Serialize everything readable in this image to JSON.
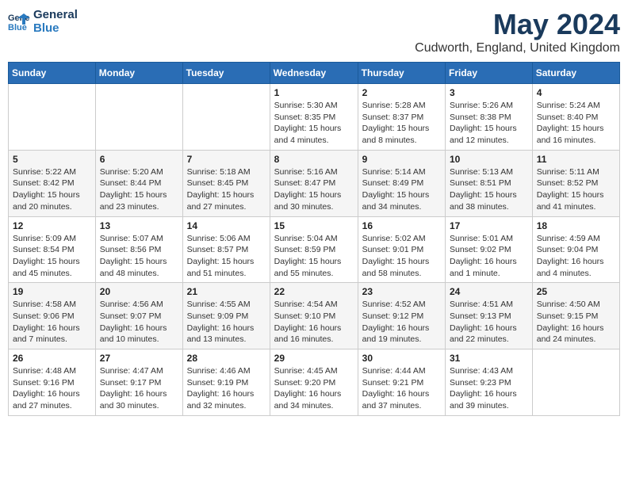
{
  "logo": {
    "line1": "General",
    "line2": "Blue"
  },
  "title": "May 2024",
  "subtitle": "Cudworth, England, United Kingdom",
  "days_of_week": [
    "Sunday",
    "Monday",
    "Tuesday",
    "Wednesday",
    "Thursday",
    "Friday",
    "Saturday"
  ],
  "weeks": [
    [
      {
        "day": "",
        "info": ""
      },
      {
        "day": "",
        "info": ""
      },
      {
        "day": "",
        "info": ""
      },
      {
        "day": "1",
        "info": "Sunrise: 5:30 AM\nSunset: 8:35 PM\nDaylight: 15 hours\nand 4 minutes."
      },
      {
        "day": "2",
        "info": "Sunrise: 5:28 AM\nSunset: 8:37 PM\nDaylight: 15 hours\nand 8 minutes."
      },
      {
        "day": "3",
        "info": "Sunrise: 5:26 AM\nSunset: 8:38 PM\nDaylight: 15 hours\nand 12 minutes."
      },
      {
        "day": "4",
        "info": "Sunrise: 5:24 AM\nSunset: 8:40 PM\nDaylight: 15 hours\nand 16 minutes."
      }
    ],
    [
      {
        "day": "5",
        "info": "Sunrise: 5:22 AM\nSunset: 8:42 PM\nDaylight: 15 hours\nand 20 minutes."
      },
      {
        "day": "6",
        "info": "Sunrise: 5:20 AM\nSunset: 8:44 PM\nDaylight: 15 hours\nand 23 minutes."
      },
      {
        "day": "7",
        "info": "Sunrise: 5:18 AM\nSunset: 8:45 PM\nDaylight: 15 hours\nand 27 minutes."
      },
      {
        "day": "8",
        "info": "Sunrise: 5:16 AM\nSunset: 8:47 PM\nDaylight: 15 hours\nand 30 minutes."
      },
      {
        "day": "9",
        "info": "Sunrise: 5:14 AM\nSunset: 8:49 PM\nDaylight: 15 hours\nand 34 minutes."
      },
      {
        "day": "10",
        "info": "Sunrise: 5:13 AM\nSunset: 8:51 PM\nDaylight: 15 hours\nand 38 minutes."
      },
      {
        "day": "11",
        "info": "Sunrise: 5:11 AM\nSunset: 8:52 PM\nDaylight: 15 hours\nand 41 minutes."
      }
    ],
    [
      {
        "day": "12",
        "info": "Sunrise: 5:09 AM\nSunset: 8:54 PM\nDaylight: 15 hours\nand 45 minutes."
      },
      {
        "day": "13",
        "info": "Sunrise: 5:07 AM\nSunset: 8:56 PM\nDaylight: 15 hours\nand 48 minutes."
      },
      {
        "day": "14",
        "info": "Sunrise: 5:06 AM\nSunset: 8:57 PM\nDaylight: 15 hours\nand 51 minutes."
      },
      {
        "day": "15",
        "info": "Sunrise: 5:04 AM\nSunset: 8:59 PM\nDaylight: 15 hours\nand 55 minutes."
      },
      {
        "day": "16",
        "info": "Sunrise: 5:02 AM\nSunset: 9:01 PM\nDaylight: 15 hours\nand 58 minutes."
      },
      {
        "day": "17",
        "info": "Sunrise: 5:01 AM\nSunset: 9:02 PM\nDaylight: 16 hours\nand 1 minute."
      },
      {
        "day": "18",
        "info": "Sunrise: 4:59 AM\nSunset: 9:04 PM\nDaylight: 16 hours\nand 4 minutes."
      }
    ],
    [
      {
        "day": "19",
        "info": "Sunrise: 4:58 AM\nSunset: 9:06 PM\nDaylight: 16 hours\nand 7 minutes."
      },
      {
        "day": "20",
        "info": "Sunrise: 4:56 AM\nSunset: 9:07 PM\nDaylight: 16 hours\nand 10 minutes."
      },
      {
        "day": "21",
        "info": "Sunrise: 4:55 AM\nSunset: 9:09 PM\nDaylight: 16 hours\nand 13 minutes."
      },
      {
        "day": "22",
        "info": "Sunrise: 4:54 AM\nSunset: 9:10 PM\nDaylight: 16 hours\nand 16 minutes."
      },
      {
        "day": "23",
        "info": "Sunrise: 4:52 AM\nSunset: 9:12 PM\nDaylight: 16 hours\nand 19 minutes."
      },
      {
        "day": "24",
        "info": "Sunrise: 4:51 AM\nSunset: 9:13 PM\nDaylight: 16 hours\nand 22 minutes."
      },
      {
        "day": "25",
        "info": "Sunrise: 4:50 AM\nSunset: 9:15 PM\nDaylight: 16 hours\nand 24 minutes."
      }
    ],
    [
      {
        "day": "26",
        "info": "Sunrise: 4:48 AM\nSunset: 9:16 PM\nDaylight: 16 hours\nand 27 minutes."
      },
      {
        "day": "27",
        "info": "Sunrise: 4:47 AM\nSunset: 9:17 PM\nDaylight: 16 hours\nand 30 minutes."
      },
      {
        "day": "28",
        "info": "Sunrise: 4:46 AM\nSunset: 9:19 PM\nDaylight: 16 hours\nand 32 minutes."
      },
      {
        "day": "29",
        "info": "Sunrise: 4:45 AM\nSunset: 9:20 PM\nDaylight: 16 hours\nand 34 minutes."
      },
      {
        "day": "30",
        "info": "Sunrise: 4:44 AM\nSunset: 9:21 PM\nDaylight: 16 hours\nand 37 minutes."
      },
      {
        "day": "31",
        "info": "Sunrise: 4:43 AM\nSunset: 9:23 PM\nDaylight: 16 hours\nand 39 minutes."
      },
      {
        "day": "",
        "info": ""
      }
    ]
  ]
}
